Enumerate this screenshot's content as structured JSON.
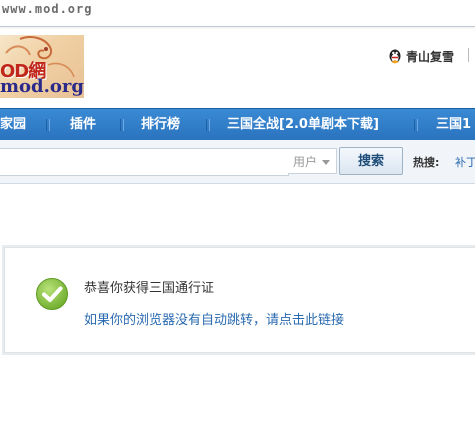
{
  "header": {
    "site_url": "www.mod.org",
    "logo_text_top": "OD網",
    "logo_text_bottom": "mod.org",
    "user": {
      "icon": "qq-penguin-icon",
      "name": "青山复雪"
    }
  },
  "nav": {
    "items": [
      "家园",
      "插件",
      "排行榜",
      "三国全战[2.0单剧本下载]",
      "三国1"
    ]
  },
  "search": {
    "input_value": "",
    "type_selected": "用户",
    "button_label": "搜索",
    "hot_label": "热搜:",
    "hot_links": [
      "补丁"
    ]
  },
  "message": {
    "icon": "check-circle-icon",
    "title": "恭喜你获得三国通行证",
    "redirect_text": "如果你的浏览器没有自动跳转，请点击此链接"
  },
  "colors": {
    "nav_bg": "#2a72be",
    "link": "#2a6ab0",
    "success": "#8cc63f"
  }
}
